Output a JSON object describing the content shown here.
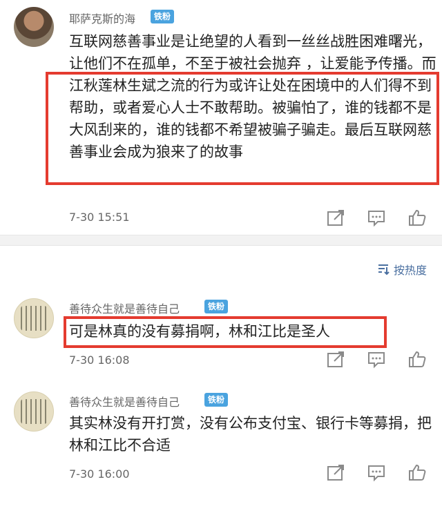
{
  "comments": [
    {
      "username": "耶萨克斯的海",
      "badge": "铁粉",
      "text": "互联网慈善事业是让绝望的人看到一丝丝战胜困难曙光，让他们不在孤单，不至于被社会抛弃 ，让爱能予传播。而江秋莲林生斌之流的行为或许让处在困境中的人们得不到帮助，或者爱心人士不敢帮助。被骗怕了，谁的钱都不是大风刮来的，谁的钱都不希望被骗子骗走。最后互联网慈善事业会成为狼来了的故事",
      "time": "7-30 15:51"
    },
    {
      "username": "善待众生就是善待自己",
      "badge": "铁粉",
      "text": "可是林真的没有募捐啊，林和江比是圣人",
      "time": "7-30 16:08"
    },
    {
      "username": "善待众生就是善待自己",
      "badge": "铁粉",
      "text": "其实林没有开打赏，没有公布支付宝、银行卡等募捐，把林和江比不合适",
      "time": "7-30 16:00"
    }
  ],
  "sort_label": "按热度",
  "icons": {
    "share": "share-icon",
    "comment": "comment-icon",
    "like": "thumbs-up-icon",
    "sort": "sort-icon"
  },
  "colors": {
    "badge": "#4aa3df",
    "highlight_border": "#e43b2f",
    "sort_text": "#4a6fa0"
  }
}
